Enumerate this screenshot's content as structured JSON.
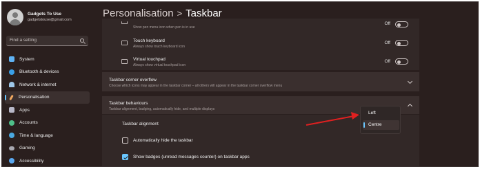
{
  "user": {
    "name": "Gadgets To Use",
    "email": "gadgetstouse@gmail.com"
  },
  "search": {
    "placeholder": "Find a setting"
  },
  "sidebar": {
    "items": [
      {
        "label": "System",
        "icon": "monitor-icon",
        "color": "#5fb3f5"
      },
      {
        "label": "Bluetooth & devices",
        "icon": "bluetooth-icon",
        "color": "#3aa0e8"
      },
      {
        "label": "Network & internet",
        "icon": "wifi-icon",
        "color": "#9ec7e8"
      },
      {
        "label": "Personalisation",
        "icon": "brush-icon",
        "color": "#f0a860",
        "active": true
      },
      {
        "label": "Apps",
        "icon": "apps-icon",
        "color": "#b8b8c8"
      },
      {
        "label": "Accounts",
        "icon": "person-icon",
        "color": "#4fc08a"
      },
      {
        "label": "Time & language",
        "icon": "globe-clock-icon",
        "color": "#4aa8e0"
      },
      {
        "label": "Gaming",
        "icon": "controller-icon",
        "color": "#a8a8b0"
      },
      {
        "label": "Accessibility",
        "icon": "accessibility-icon",
        "color": "#5aa8f0"
      }
    ]
  },
  "breadcrumb": {
    "parent": "Personalisation",
    "separator": ">",
    "current": "Taskbar"
  },
  "corner_icons": {
    "rows": [
      {
        "title": "",
        "subtitle": "Show pen menu icon when pen is in use",
        "state": "Off"
      },
      {
        "title": "Touch keyboard",
        "subtitle": "Always show touch keyboard icon",
        "state": "Off"
      },
      {
        "title": "Virtual touchpad",
        "subtitle": "Always show virtual touchpad icon",
        "state": "Off"
      }
    ]
  },
  "overflow_section": {
    "title": "Taskbar corner overflow",
    "subtitle": "Choose which icons may appear in the taskbar corner – all others will appear in the taskbar corner overflow menu"
  },
  "behaviours_section": {
    "title": "Taskbar behaviours",
    "subtitle": "Taskbar alignment, badging, automatically hide, and multiple displays",
    "alignment_label": "Taskbar alignment",
    "alignment_options": [
      "Left",
      "Centre"
    ],
    "alignment_selected": "Centre",
    "auto_hide_label": "Automatically hide the taskbar",
    "auto_hide_checked": false,
    "badges_label": "Show badges (unread messages counter) on taskbar apps",
    "badges_checked": true
  },
  "colors": {
    "accent": "#6ac7ff",
    "annotation_arrow": "#e02020"
  }
}
